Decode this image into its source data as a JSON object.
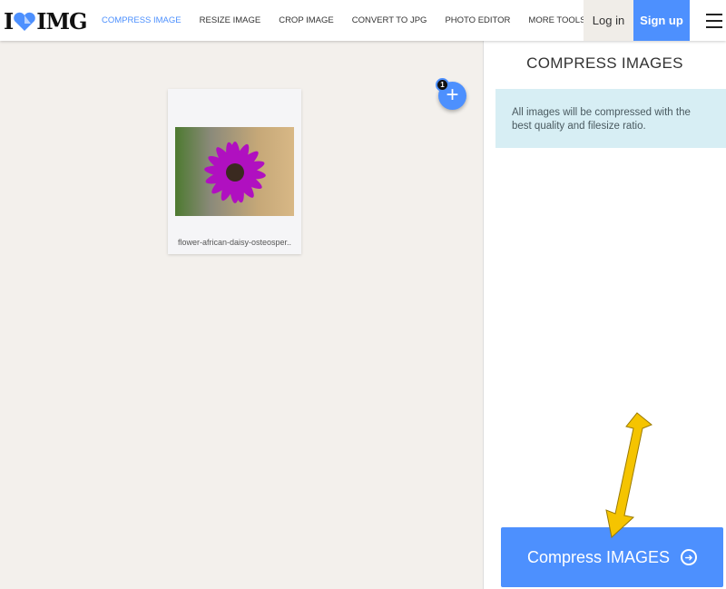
{
  "header": {
    "logo": {
      "left": "I",
      "right": "IMG"
    },
    "nav": [
      "COMPRESS IMAGE",
      "RESIZE IMAGE",
      "CROP IMAGE",
      "CONVERT TO JPG",
      "PHOTO EDITOR",
      "MORE TOOLS ▾"
    ],
    "login": "Log in",
    "signup": "Sign up"
  },
  "workspace": {
    "file_name": "flower-african-daisy-osteosper..",
    "file_count": "1"
  },
  "sidebar": {
    "title": "COMPRESS IMAGES",
    "info": "All images will be compressed with the best quality and filesize ratio.",
    "button": "Compress IMAGES"
  },
  "colors": {
    "accent": "#4d90fe",
    "info_bg": "#d7eef4",
    "annotation_arrow": "#f5c400"
  }
}
